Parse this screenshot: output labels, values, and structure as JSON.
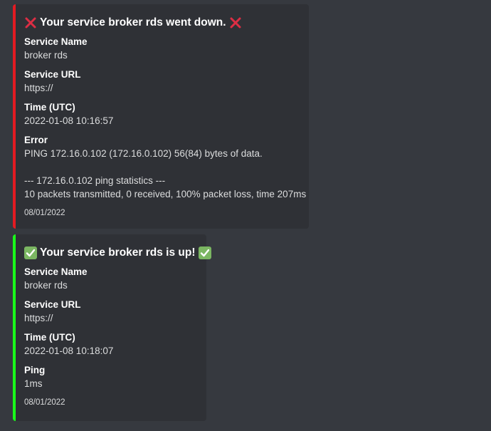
{
  "down_embed": {
    "accent_color": "#e31b22",
    "title_icon": "cross-mark-icon",
    "title": "Your service broker rds went down.",
    "fields": [
      {
        "name": "Service Name",
        "value": "broker rds"
      },
      {
        "name": "Service URL",
        "value": "https://"
      },
      {
        "name": "Time (UTC)",
        "value": "2022-01-08 10:16:57"
      },
      {
        "name": "Error",
        "value": "PING 172.16.0.102 (172.16.0.102) 56(84) bytes of data.\n\n--- 172.16.0.102 ping statistics ---\n10 packets transmitted, 0 received, 100% packet loss, time 207ms"
      }
    ],
    "footer": "08/01/2022"
  },
  "up_embed": {
    "accent_color": "#1aff1a",
    "title_icon": "check-mark-icon",
    "title": "Your service broker rds is up!",
    "fields": [
      {
        "name": "Service Name",
        "value": "broker rds"
      },
      {
        "name": "Service URL",
        "value": "https://"
      },
      {
        "name": "Time (UTC)",
        "value": "2022-01-08 10:18:07"
      },
      {
        "name": "Ping",
        "value": "1ms"
      }
    ],
    "footer": "08/01/2022"
  }
}
